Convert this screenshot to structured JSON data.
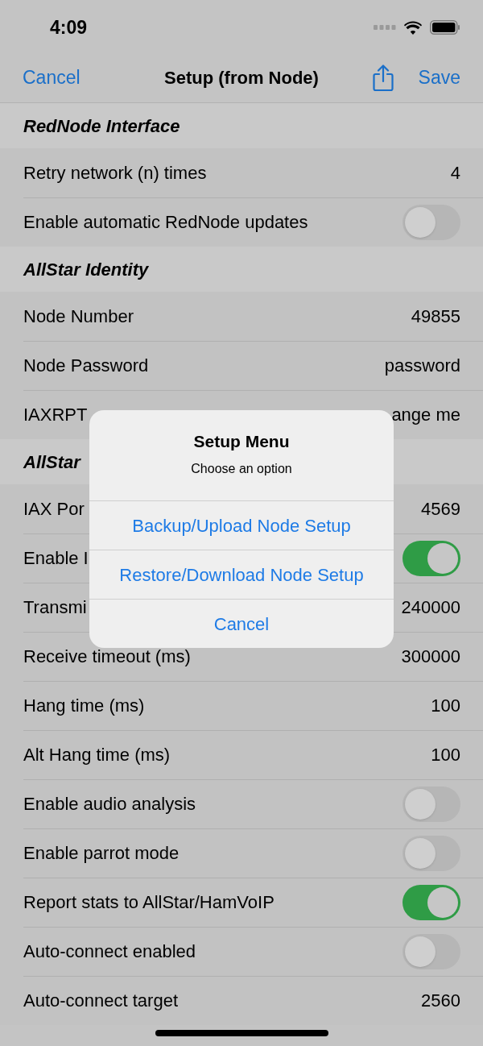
{
  "status_bar": {
    "time": "4:09"
  },
  "nav_bar": {
    "left_button": "Cancel",
    "title": "Setup (from Node)",
    "right_button": "Save"
  },
  "sections": [
    {
      "header": "RedNode Interface",
      "rows": [
        {
          "kind": "value",
          "label": "Retry network (n) times",
          "value": "4"
        },
        {
          "kind": "toggle",
          "label": "Enable automatic RedNode updates",
          "on": false
        }
      ]
    },
    {
      "header": "AllStar Identity",
      "rows": [
        {
          "kind": "value",
          "label": "Node Number",
          "value": "49855"
        },
        {
          "kind": "value",
          "label": "Node Password",
          "value": "password"
        },
        {
          "kind": "value",
          "label": "IAXRPT",
          "value": "ange me"
        }
      ]
    },
    {
      "header": "AllStar",
      "rows": [
        {
          "kind": "value",
          "label": "IAX Por",
          "value": "4569"
        },
        {
          "kind": "toggle",
          "label": "Enable I",
          "on": true
        },
        {
          "kind": "value",
          "label": "Transmi",
          "value": "240000"
        },
        {
          "kind": "value",
          "label": "Receive timeout (ms)",
          "value": "300000"
        },
        {
          "kind": "value",
          "label": "Hang time (ms)",
          "value": "100"
        },
        {
          "kind": "value",
          "label": "Alt Hang time (ms)",
          "value": "100"
        },
        {
          "kind": "toggle",
          "label": "Enable audio analysis",
          "on": false
        },
        {
          "kind": "toggle",
          "label": "Enable parrot mode",
          "on": false
        },
        {
          "kind": "toggle",
          "label": "Report stats to AllStar/HamVoIP",
          "on": true
        },
        {
          "kind": "toggle",
          "label": "Auto-connect enabled",
          "on": false
        },
        {
          "kind": "value",
          "label": "Auto-connect target",
          "value": "2560"
        }
      ]
    }
  ],
  "alert": {
    "title": "Setup Menu",
    "message": "Choose an option",
    "actions": [
      "Backup/Upload Node Setup",
      "Restore/Download Node Setup",
      "Cancel"
    ]
  }
}
